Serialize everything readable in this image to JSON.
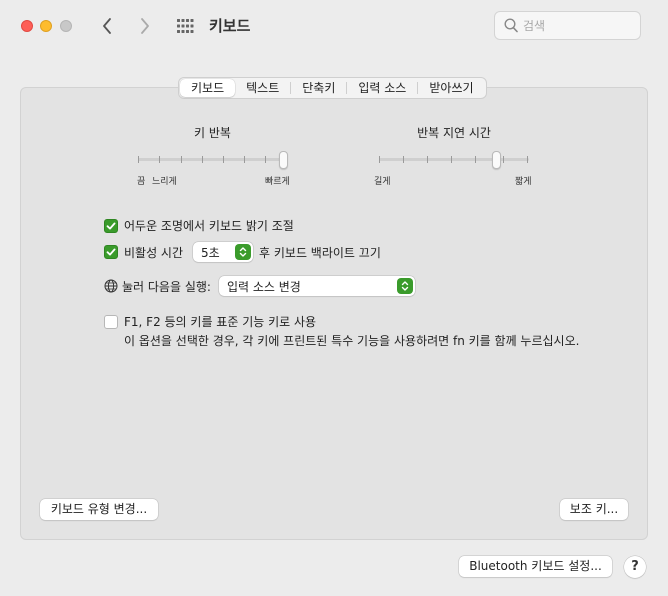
{
  "window": {
    "title": "키보드",
    "search_placeholder": "검색"
  },
  "tabs": [
    {
      "label": "키보드",
      "active": true
    },
    {
      "label": "텍스트",
      "active": false
    },
    {
      "label": "단축키",
      "active": false
    },
    {
      "label": "입력 소스",
      "active": false
    },
    {
      "label": "받아쓰기",
      "active": false
    }
  ],
  "key_repeat": {
    "title": "키 반복",
    "left_label": "끔",
    "left_label2": "느리게",
    "right_label": "빠르게",
    "value_fraction": 1.0
  },
  "repeat_delay": {
    "title": "반복 지연 시간",
    "left_label": "길게",
    "right_label": "짧게",
    "value_fraction": 0.8
  },
  "options": {
    "adjust_brightness": {
      "label": "어두운 조명에서 키보드 밝기 조절",
      "checked": true
    },
    "backlight_off": {
      "label_prefix": "비활성 시간",
      "value": "5초",
      "label_suffix": "후 키보드 백라이트 끄기",
      "checked": true
    },
    "globe_key": {
      "label": "눌러 다음을 실행:",
      "value": "입력 소스 변경"
    },
    "fn_keys": {
      "label": "F1, F2 등의 키를 표준 기능 키로 사용",
      "description": "이 옵션을 선택한 경우, 각 키에 프린트된 특수 기능을 사용하려면 fn 키를 함께 누르십시오.",
      "checked": false
    }
  },
  "buttons": {
    "change_type": "키보드 유형 변경...",
    "modifier_keys": "보조 키...",
    "bluetooth_setup": "Bluetooth 키보드 설정...",
    "help": "?"
  },
  "colors": {
    "accent": "#3a9b2b",
    "close": "#fe5f57",
    "minimize": "#febc2e"
  }
}
